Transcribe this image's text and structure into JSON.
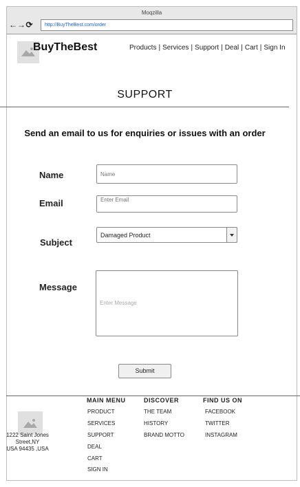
{
  "browser": {
    "window_title": "Moqzilla",
    "back_icon": "←",
    "forward_icon": "→",
    "reload_icon": "⟳",
    "url": "http://BuyTheBest.com/order"
  },
  "header": {
    "brand": "BuyTheBest",
    "nav": [
      "Products",
      "Services",
      "Support",
      "Deal",
      "Cart",
      "Sign In"
    ],
    "separator": "|"
  },
  "page": {
    "title": "SUPPORT",
    "intro": "Send an email to us for enquiries or issues with an order"
  },
  "form": {
    "name_label": "Name",
    "name_placeholder": "Name",
    "email_label": "Email",
    "email_placeholder": "Enter Email",
    "subject_label": "Subject",
    "subject_value": "Damaged Product",
    "message_label": "Message",
    "message_placeholder": "Enter Message",
    "submit_label": "Submit"
  },
  "footer": {
    "address_line1": "1222 Saint Jones",
    "address_line2": "Street,NY",
    "address_line3": "USA 94435 ,USA",
    "columns": [
      {
        "heading": "MAIN MENU",
        "items": [
          "PRODUCT",
          "SERVICES",
          "SUPPORT",
          "DEAL",
          "CART",
          "SIGN IN"
        ]
      },
      {
        "heading": "DISCOVER",
        "items": [
          "THE TEAM",
          "HISTORY",
          "BRAND MOTTO"
        ]
      },
      {
        "heading": "FIND US ON",
        "items": [
          "FACEBOOK",
          "TWITTER",
          "INSTAGRAM"
        ]
      }
    ]
  }
}
